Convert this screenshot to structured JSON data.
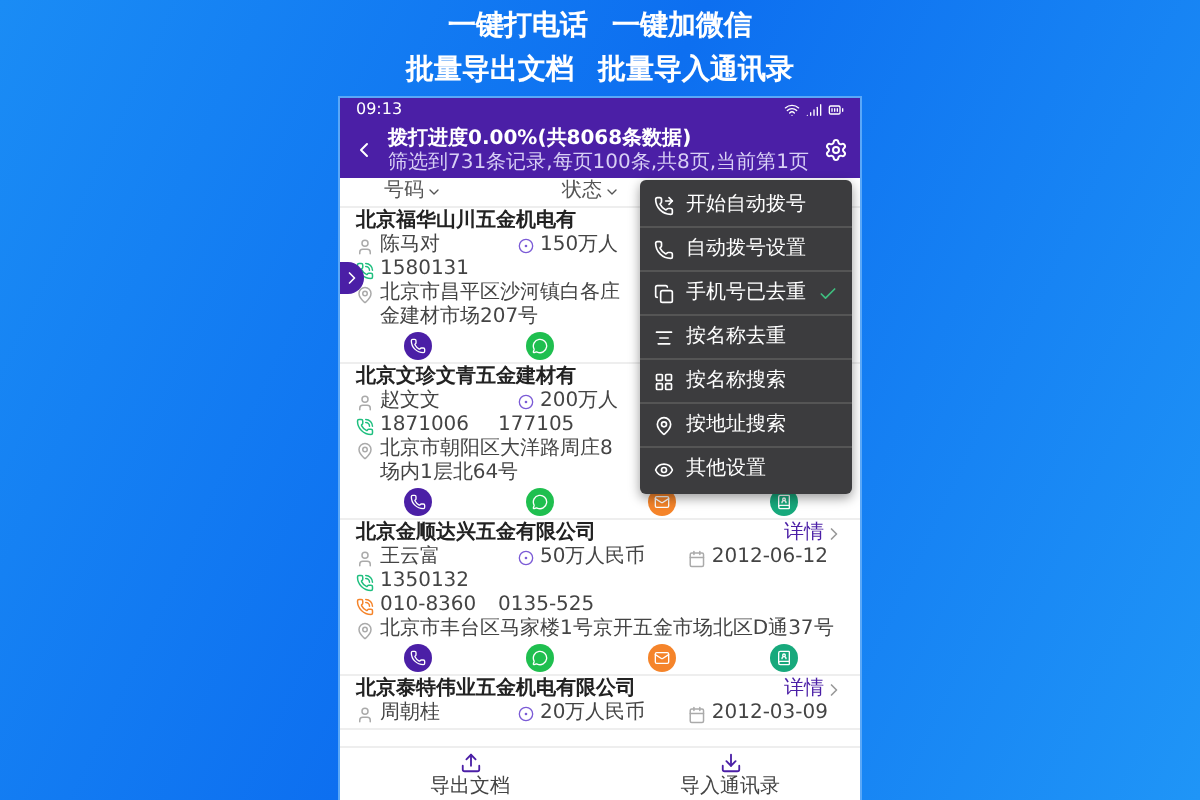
{
  "headline": [
    {
      "items": [
        "一键打电话",
        "一键加微信"
      ]
    },
    {
      "items": [
        "批量导出文档",
        "批量导入通讯录"
      ]
    }
  ],
  "status_bar": {
    "time": "09:13"
  },
  "header": {
    "title": "拨打进度0.00%(共8068条数据)",
    "subtitle": "筛选到731条记录,每页100条,共8页,当前第1页"
  },
  "columns": [
    {
      "label": "号码"
    },
    {
      "label": "状态"
    }
  ],
  "companies": [
    {
      "name": "北京福华山川五金机电有",
      "contact": "陈马对",
      "capital": "150万人",
      "phones": [
        {
          "kind": "mobile",
          "numbers": [
            "1580131"
          ]
        }
      ],
      "address_lines": [
        "北京市昌平区沙河镇白各庄",
        "金建材市场207号"
      ]
    },
    {
      "name": "北京文珍文青五金建材有",
      "contact": "赵文文",
      "capital": "200万人",
      "phones": [
        {
          "kind": "mobile",
          "numbers": [
            "1871006",
            "177105"
          ]
        }
      ],
      "address_lines": [
        "北京市朝阳区大洋路周庄8",
        "场内1层北64号"
      ]
    },
    {
      "name": "北京金顺达兴五金有限公司",
      "detail": "详情",
      "contact": "王云富",
      "capital": "50万人民币",
      "date": "2012-06-12",
      "phones": [
        {
          "kind": "mobile",
          "numbers": [
            "1350132"
          ]
        },
        {
          "kind": "landline",
          "numbers": [
            "010-8360",
            "0135-525"
          ]
        }
      ],
      "address_lines": [
        "北京市丰台区马家楼1号京开五金市场北区D通37号"
      ]
    },
    {
      "name": "北京泰特伟业五金机电有限公司",
      "detail": "详情",
      "contact": "周朝桂",
      "capital": "20万人民币",
      "date": "2012-03-09"
    }
  ],
  "menu": {
    "items": [
      {
        "label": "开始自动拨号",
        "checked": false
      },
      {
        "label": "自动拨号设置",
        "checked": false
      },
      {
        "label": "手机号已去重",
        "checked": true
      },
      {
        "label": "按名称去重",
        "checked": false
      },
      {
        "label": "按名称搜索",
        "checked": false
      },
      {
        "label": "按地址搜索",
        "checked": false
      },
      {
        "label": "其他设置",
        "checked": false
      }
    ]
  },
  "bottom_bar": [
    {
      "kind": "export",
      "label": "导出文档"
    },
    {
      "kind": "import",
      "label": "导入通讯录"
    }
  ]
}
